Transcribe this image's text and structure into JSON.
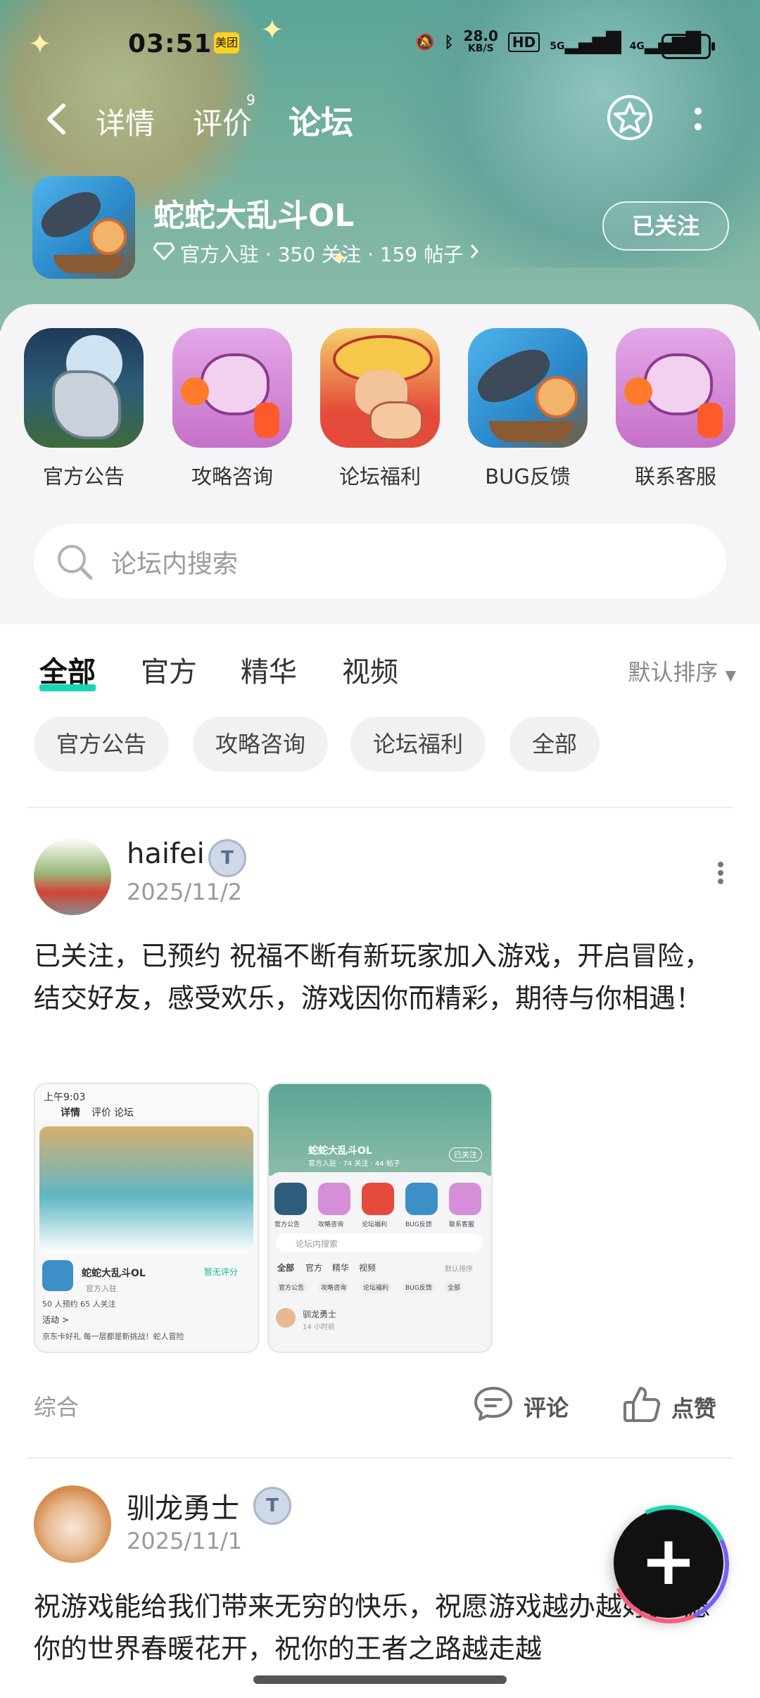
{
  "status_bar": {
    "time": "03:51",
    "meituan_label": "美团",
    "net_speed_value": "28.0",
    "net_speed_unit": "KB/S",
    "hd_label": "HD",
    "sig1_label": "5G",
    "sig2_label": "4G",
    "battery": "56"
  },
  "nav": {
    "tabs": [
      {
        "label": "详情"
      },
      {
        "label": "评价",
        "badge": "9"
      },
      {
        "label": "论坛"
      }
    ],
    "active_tab": "论坛"
  },
  "game": {
    "name": "蛇蛇大乱斗OL",
    "meta": "官方入驻 · 350 关注 · 159 帖子",
    "follow_label": "已关注"
  },
  "categories": [
    {
      "label": "官方公告"
    },
    {
      "label": "攻略咨询"
    },
    {
      "label": "论坛福利"
    },
    {
      "label": "BUG反馈"
    },
    {
      "label": "联系客服"
    }
  ],
  "search": {
    "placeholder": "论坛内搜索"
  },
  "filter_tabs": [
    "全部",
    "官方",
    "精华",
    "视频"
  ],
  "active_filter": "全部",
  "sort_label": "默认排序",
  "chips": [
    "官方公告",
    "攻略咨询",
    "论坛福利",
    "全部"
  ],
  "posts": [
    {
      "user": "haifei",
      "badge": "T",
      "date": "2025/11/2",
      "text": "已关注，已预约 祝福不断有新玩家加入游戏，开启冒险，结交好友，感受欢乐，游戏因你而精彩，期待与你相遇！",
      "tag": "综合",
      "comment_label": "评论",
      "like_label": "点赞",
      "thumb1": {
        "time": "上午9:03",
        "tabs": [
          "详情",
          "评价",
          "论坛"
        ],
        "game": "蛇蛇大乱斗OL",
        "rating": "暂无评分",
        "official": "官方入驻",
        "stats": "50 人预约   65 人关注",
        "activity": "活动 >",
        "promo": "京东卡好礼 每一层都是新挑战！蛇人冒险"
      },
      "thumb2": {
        "game": "蛇蛇大乱斗OL",
        "meta": "官方入驻 · 74 关注 · 44 帖子",
        "follow": "已关注",
        "cats": [
          "官方公告",
          "攻略咨询",
          "论坛福利",
          "BUG反馈",
          "联系客服"
        ],
        "search": "论坛内搜索",
        "tabs": [
          "全部",
          "官方",
          "精华",
          "视频"
        ],
        "sort": "默认排序",
        "chips": [
          "官方公告",
          "攻略咨询",
          "论坛福利",
          "BUG反馈",
          "全部"
        ],
        "user": "驯龙勇士",
        "ago": "14 小时前"
      }
    },
    {
      "user": "驯龙勇士",
      "badge": "T",
      "date": "2025/11/1",
      "text": "祝游戏能给我们带来无穷的快乐，祝愿游戏越办越好。 愿你的世界春暖花开，祝你的王者之路越走越"
    }
  ]
}
